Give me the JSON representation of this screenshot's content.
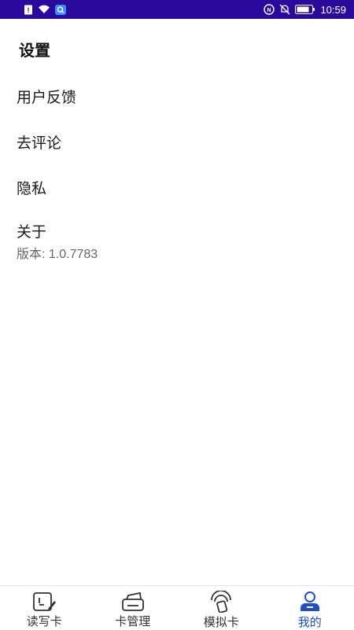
{
  "status_bar": {
    "time": "10:59",
    "background": "#2a0a9c",
    "left_icons": [
      "sim-alert-icon",
      "wifi-icon",
      "app-notification-icon"
    ],
    "right_icons": [
      "nfc-icon",
      "mute-icon",
      "battery-icon"
    ]
  },
  "settings": {
    "title": "设置",
    "items": [
      {
        "label": "用户反馈"
      },
      {
        "label": "去评论"
      },
      {
        "label": "隐私"
      },
      {
        "label": "关于",
        "sub": "版本: 1.0.7783"
      }
    ]
  },
  "bottom_nav": {
    "active_color": "#1f4fc4",
    "tabs": [
      {
        "label": "读写卡",
        "icon": "read-write-card-icon",
        "active": false
      },
      {
        "label": "卡管理",
        "icon": "card-manage-icon",
        "active": false
      },
      {
        "label": "模拟卡",
        "icon": "emulate-card-icon",
        "active": false
      },
      {
        "label": "我的",
        "icon": "profile-icon",
        "active": true
      }
    ]
  }
}
